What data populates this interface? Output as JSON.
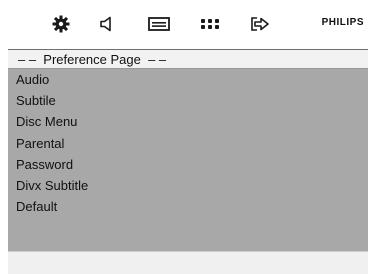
{
  "toolbar": {
    "icons": [
      "gear-icon",
      "speaker-icon",
      "subtitle-icon",
      "dots-grid-icon",
      "exit-arrow-icon"
    ],
    "brand": "PHILIPS"
  },
  "menu": {
    "title": "– –  Preference Page  – –",
    "items": [
      "Audio",
      "Subtile",
      "Disc Menu",
      "Parental",
      "Password",
      "Divx Subtitle",
      "Default"
    ]
  },
  "colors": {
    "panel": "#a8a8a8",
    "header": "#f2f2f2",
    "background": "#ffffff"
  }
}
